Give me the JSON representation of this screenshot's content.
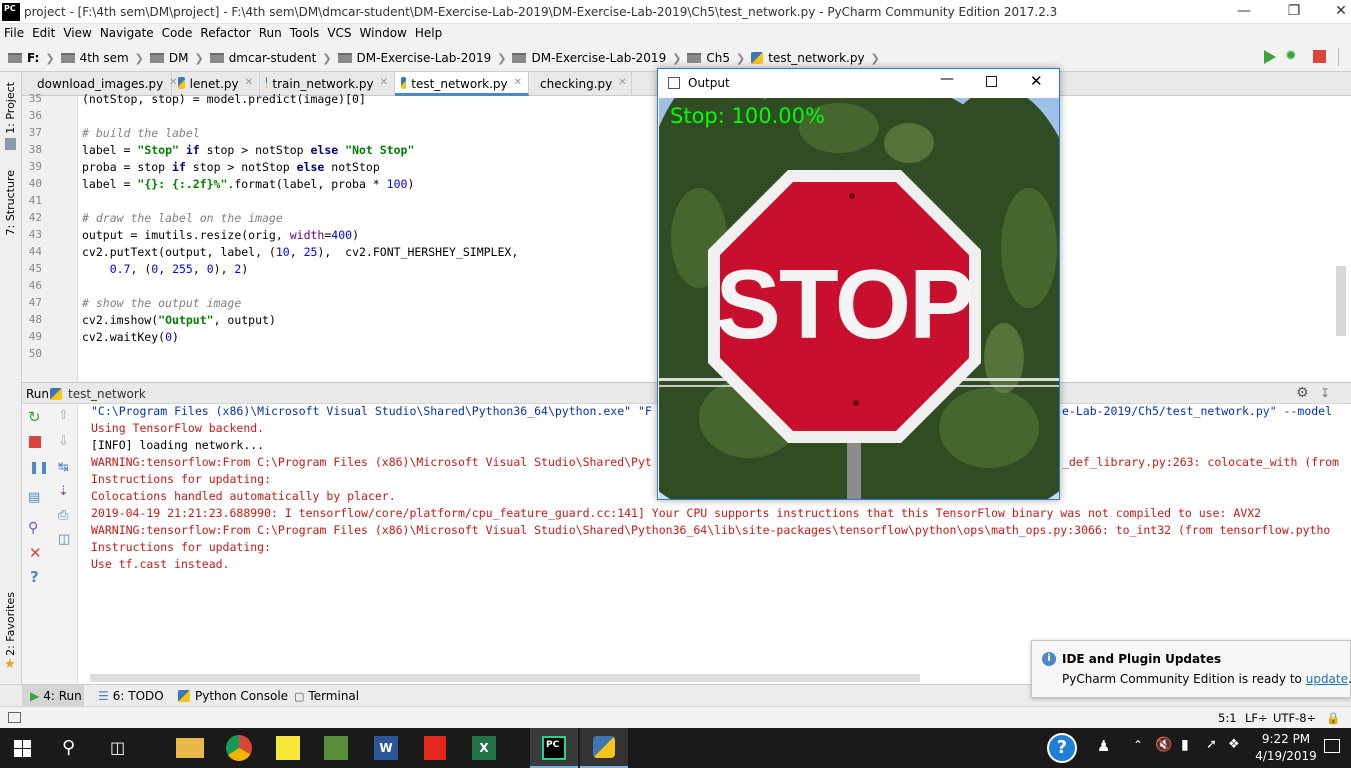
{
  "window": {
    "title": "project - [F:\\4th sem\\DM\\project] - F:\\4th sem\\DM\\dmcar-student\\DM-Exercise-Lab-2019\\DM-Exercise-Lab-2019\\Ch5\\test_network.py - PyCharm Community Edition 2017.2.3",
    "app_icon": "PC"
  },
  "menu": [
    "File",
    "Edit",
    "View",
    "Navigate",
    "Code",
    "Refactor",
    "Run",
    "Tools",
    "VCS",
    "Window",
    "Help"
  ],
  "breadcrumbs": [
    "F:",
    "4th sem",
    "DM",
    "dmcar-student",
    "DM-Exercise-Lab-2019",
    "DM-Exercise-Lab-2019",
    "Ch5",
    "test_network.py"
  ],
  "run_config": "test_network",
  "tabs": [
    {
      "label": "download_images.py",
      "active": false
    },
    {
      "label": "lenet.py",
      "active": false
    },
    {
      "label": "train_network.py",
      "active": false
    },
    {
      "label": "test_network.py",
      "active": true
    },
    {
      "label": "checking.py",
      "active": false
    }
  ],
  "left_tools": [
    "1: Project",
    "7: Structure",
    "2: Favorites"
  ],
  "editor": {
    "line_numbers": [
      "35",
      "36",
      "37",
      "38",
      "39",
      "40",
      "41",
      "42",
      "43",
      "44",
      "45",
      "46",
      "47",
      "48",
      "49",
      "50"
    ],
    "top_partial": "(notStop, stop) = model.predict(image)[0]",
    "comment_build": "# build the label",
    "comment_draw": "# draw the label on the image",
    "comment_show": "# show the output image"
  },
  "run_panel": {
    "label": "Run",
    "config": "test_network",
    "console_lines": [
      {
        "text": "\"C:\\Program Files (x86)\\Microsoft Visual Studio\\Shared\\Python36_64\\python.exe\" \"F",
        "color": "blue"
      },
      {
        "text": "Using TensorFlow backend.",
        "color": "red"
      },
      {
        "text": "[INFO] loading network...",
        "color": "black"
      },
      {
        "text": "WARNING:tensorflow:From C:\\Program Files (x86)\\Microsoft Visual Studio\\Shared\\Pyt",
        "color": "red"
      },
      {
        "text": "Instructions for updating:",
        "color": "red"
      },
      {
        "text": "Colocations handled automatically by placer.",
        "color": "red"
      },
      {
        "text": "2019-04-19 21:21:23.688990: I tensorflow/core/platform/cpu_feature_guard.cc:141] Your CPU supports instructions that this TensorFlow binary was not compiled to use: AVX2",
        "color": "red"
      },
      {
        "text": "WARNING:tensorflow:From C:\\Program Files (x86)\\Microsoft Visual Studio\\Shared\\Python36_64\\lib\\site-packages\\tensorflow\\python\\ops\\math_ops.py:3066: to_int32 (from tensorflow.pytho",
        "color": "red"
      },
      {
        "text": "Instructions for updating:",
        "color": "red"
      },
      {
        "text": "Use tf.cast instead.",
        "color": "red"
      }
    ],
    "right_fragment_1": "e-Lab-2019/Ch5/test_network.py\" --model",
    "right_fragment_2": "_def_library.py:263: colocate_with (from"
  },
  "bottom_tabs": [
    "4: Run",
    "6: TODO",
    "Python Console",
    "Terminal"
  ],
  "status": {
    "position": "5:1",
    "line_sep": "LF÷",
    "encoding": "UTF-8÷"
  },
  "output_window": {
    "title": "Output",
    "overlay_text": "Stop: 100.00%",
    "sign_text": "STOP"
  },
  "notification": {
    "title": "IDE and Plugin Updates",
    "body": "PyCharm Community Edition is ready to",
    "link": "update",
    "period": "."
  },
  "taskbar": {
    "time": "9:22 PM",
    "date": "4/19/2019"
  },
  "colors": {
    "accent": "#4a88c7",
    "console_red": "#c41a16",
    "overlay_green": "#00ff00",
    "stop_red": "#c8102e"
  }
}
